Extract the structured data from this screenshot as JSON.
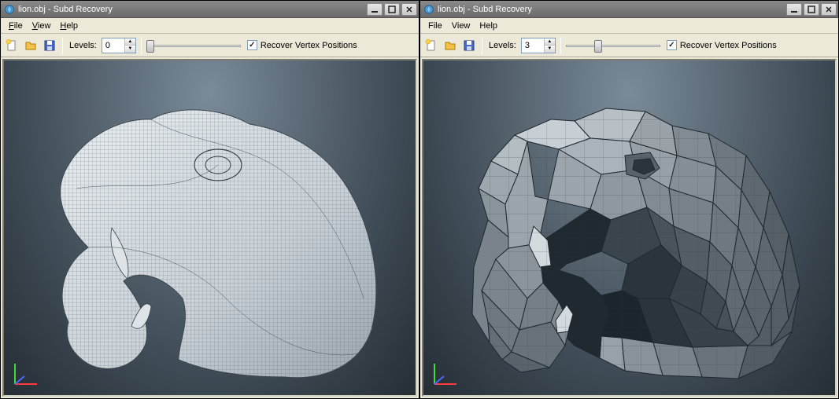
{
  "windows": [
    {
      "title": "lion.obj - Subd Recovery",
      "menu": {
        "file": "File",
        "view": "View",
        "help": "Help"
      },
      "toolbar": {
        "levels_label": "Levels:",
        "levels_value": "0",
        "slider_percent": 0,
        "checkbox_checked": true,
        "checkbox_label": "Recover Vertex Positions"
      },
      "mesh_density": "high"
    },
    {
      "title": "lion.obj - Subd Recovery",
      "menu": {
        "file": "File",
        "view": "View",
        "help": "Help"
      },
      "toolbar": {
        "levels_label": "Levels:",
        "levels_value": "3",
        "slider_percent": 30,
        "checkbox_checked": true,
        "checkbox_label": "Recover Vertex Positions"
      },
      "mesh_density": "low"
    }
  ],
  "icons": {
    "new": "new-file-icon",
    "open": "open-folder-icon",
    "save": "save-icon"
  }
}
